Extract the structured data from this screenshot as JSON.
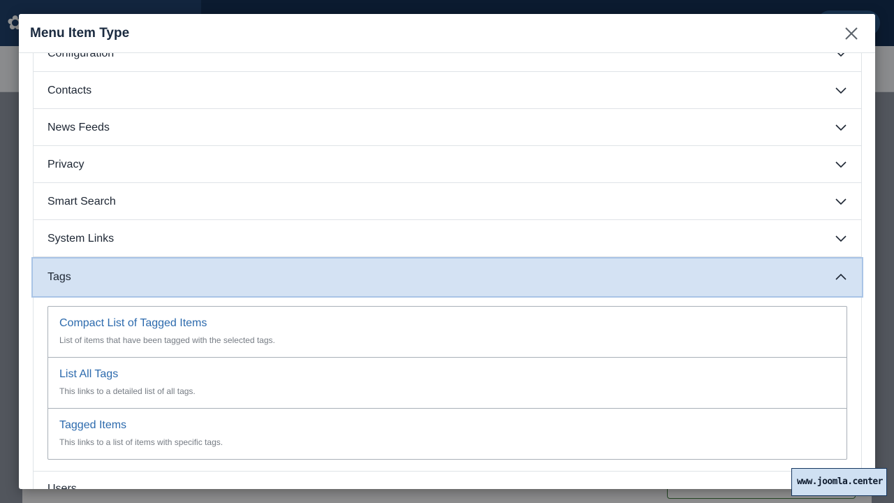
{
  "modal": {
    "title": "Menu Item Type",
    "close_icon": "close-icon"
  },
  "accordion": {
    "partial_top_label": "Configuration",
    "items": [
      {
        "label": "Contacts",
        "state": "collapsed"
      },
      {
        "label": "News Feeds",
        "state": "collapsed"
      },
      {
        "label": "Privacy",
        "state": "collapsed"
      },
      {
        "label": "Smart Search",
        "state": "collapsed"
      },
      {
        "label": "System Links",
        "state": "collapsed"
      }
    ],
    "open_item": {
      "label": "Tags",
      "state": "expanded",
      "entries": [
        {
          "title": "Compact List of Tagged Items",
          "description": "List of items that have been tagged with the selected tags."
        },
        {
          "title": "List All Tags",
          "description": "This links to a detailed list of all tags."
        },
        {
          "title": "Tagged Items",
          "description": "This links to a list of items with specific tags."
        }
      ]
    },
    "partial_bottom_label": "Users"
  },
  "watermark": {
    "text": "www.joomla.center"
  },
  "colors": {
    "header_bg": "#132f53",
    "open_item_bg": "#d4e2f3",
    "link_color": "#2c6aad"
  }
}
